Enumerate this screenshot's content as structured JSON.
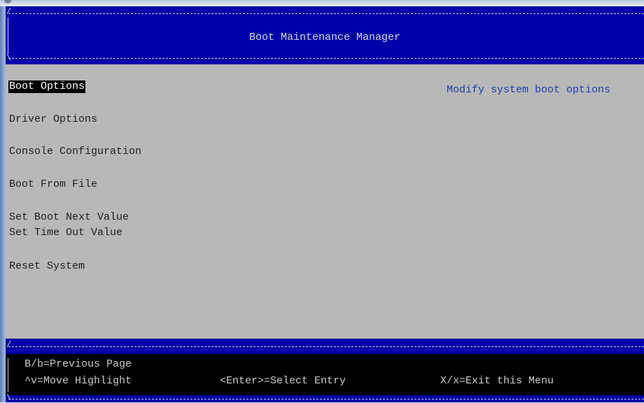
{
  "header": {
    "title": "Boot Maintenance Manager"
  },
  "menu": {
    "items": [
      {
        "label": "Boot Options"
      },
      {
        "label": "Driver Options"
      },
      {
        "label": "Console Configuration"
      },
      {
        "label": "Boot From File"
      },
      {
        "label": "Set Boot Next Value"
      },
      {
        "label": "Set Time Out Value"
      },
      {
        "label": "Reset System"
      }
    ]
  },
  "help": {
    "text": "Modify system boot options"
  },
  "footer": {
    "prev_page": "B/b=Previous Page",
    "move_highlight": "^v=Move Highlight",
    "select_entry": "<Enter>=Select Entry",
    "exit_menu": "X/x=Exit this Menu"
  },
  "colors": {
    "header_bg": "#0000aa",
    "body_bg": "#b8b8b8",
    "highlight_bg": "#000000",
    "help_text": "#1a3faa"
  }
}
